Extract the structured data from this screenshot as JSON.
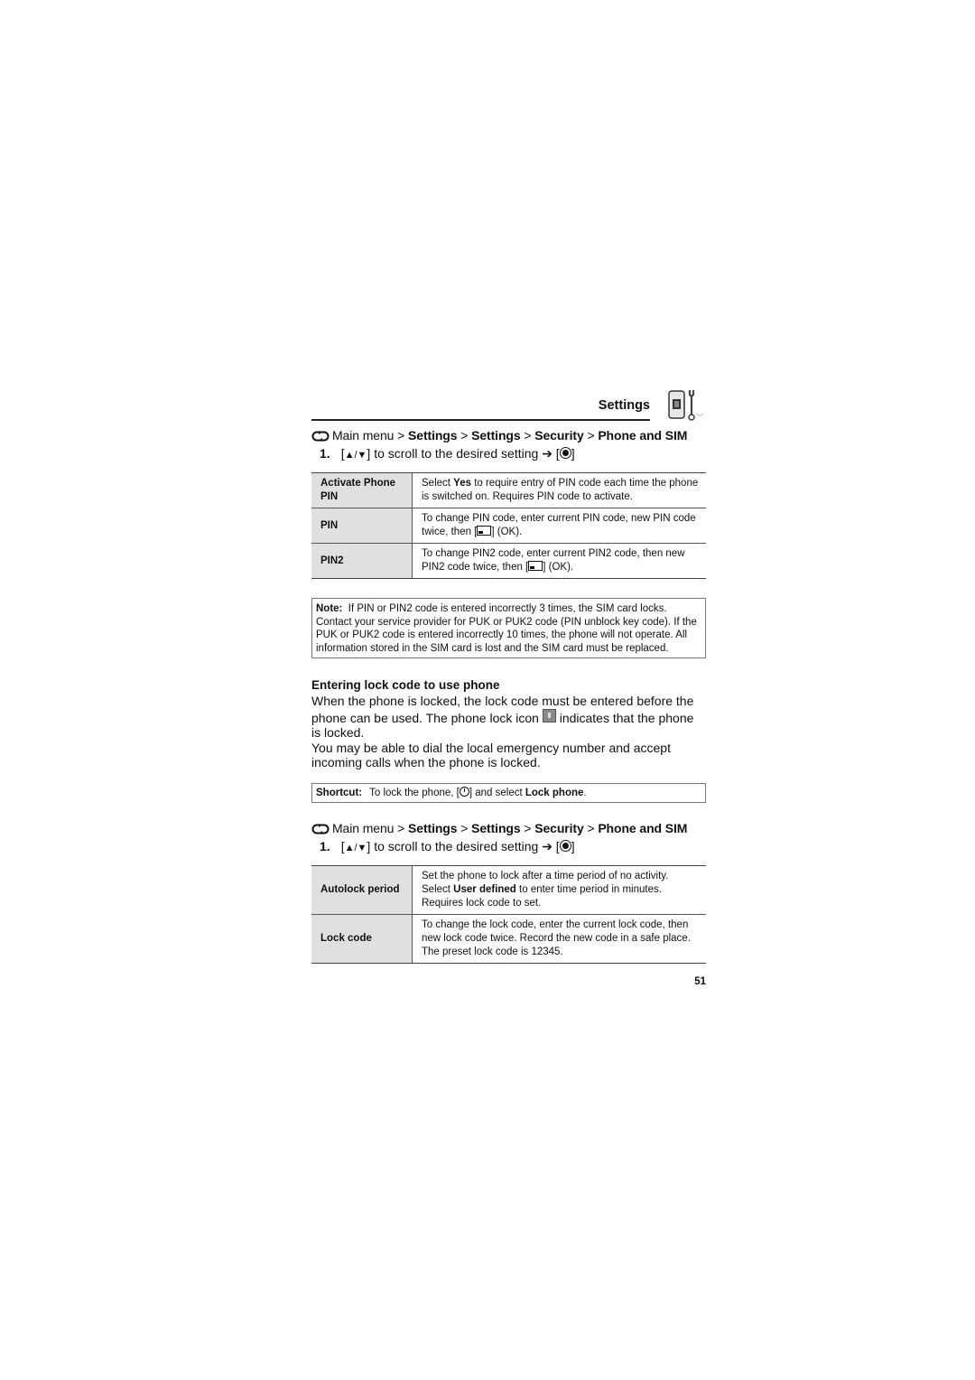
{
  "header": {
    "section_title": "Settings",
    "section_icon": "phone-wrench-icon"
  },
  "nav_path_1": {
    "icon": "menu-loop-icon",
    "prefix": "Main menu",
    "sep": " > ",
    "items": [
      "Settings",
      "Settings",
      "Security",
      "Phone and SIM"
    ]
  },
  "step_1": {
    "number": "1.",
    "keys": "▲/▼",
    "text": " to scroll to the desired setting ",
    "arrow": "➔",
    "confirm_icon": "center-select-icon"
  },
  "table_1": {
    "rows": [
      {
        "key": "Activate Phone PIN",
        "val_pre": "Select ",
        "val_bold": "Yes",
        "val_post": " to require entry of PIN code each time the phone is switched on. Requires PIN code to activate."
      },
      {
        "key": "PIN",
        "val_pre": "To change PIN code, enter current PIN code, new PIN code twice, then [",
        "val_icon": "softkey-icon",
        "val_post": "] (OK)."
      },
      {
        "key": "PIN2",
        "val_pre": "To change PIN2 code, enter current PIN2 code, then new PIN2 code twice, then [",
        "val_icon": "softkey-icon",
        "val_post": "] (OK)."
      }
    ]
  },
  "note": {
    "label": "Note:",
    "text": "If PIN or PIN2 code is entered incorrectly 3 times, the SIM card locks. Contact your service provider for PUK or PUK2 code (PIN unblock key code). If the PUK or PUK2 code is entered incorrectly 10 times, the phone will not operate. All information stored in the SIM card is lost and the SIM card must be replaced."
  },
  "lock_section": {
    "heading": "Entering lock code to use phone",
    "para1_pre": "When the phone is locked, the lock code must be entered before the phone can be used. The phone lock icon ",
    "para1_post": " indicates that the phone is locked.",
    "para2": "You may be able to dial the local emergency number and accept incoming calls when the phone is locked."
  },
  "shortcut": {
    "label": "Shortcut:",
    "text_pre": "To lock the phone, [",
    "text_mid": "] and select ",
    "text_bold": "Lock phone",
    "text_post": "."
  },
  "nav_path_2": {
    "prefix": "Main menu",
    "sep": " > ",
    "items": [
      "Settings",
      "Settings",
      "Security",
      "Phone and SIM"
    ]
  },
  "step_2": {
    "number": "1.",
    "keys": "▲/▼",
    "text": " to scroll to the desired setting ",
    "arrow": "➔"
  },
  "table_2": {
    "rows": [
      {
        "key": "Autolock period",
        "val_pre": "Set the phone to lock after a time period of no activity. Select ",
        "val_bold": "User defined",
        "val_post": " to enter time period in minutes. Requires lock code to set."
      },
      {
        "key": "Lock code",
        "val_pre": "To change the lock code, enter the current lock code, then new lock code twice. Record the new code in a safe place. The preset lock code is 12345."
      }
    ]
  },
  "page_number": "51"
}
